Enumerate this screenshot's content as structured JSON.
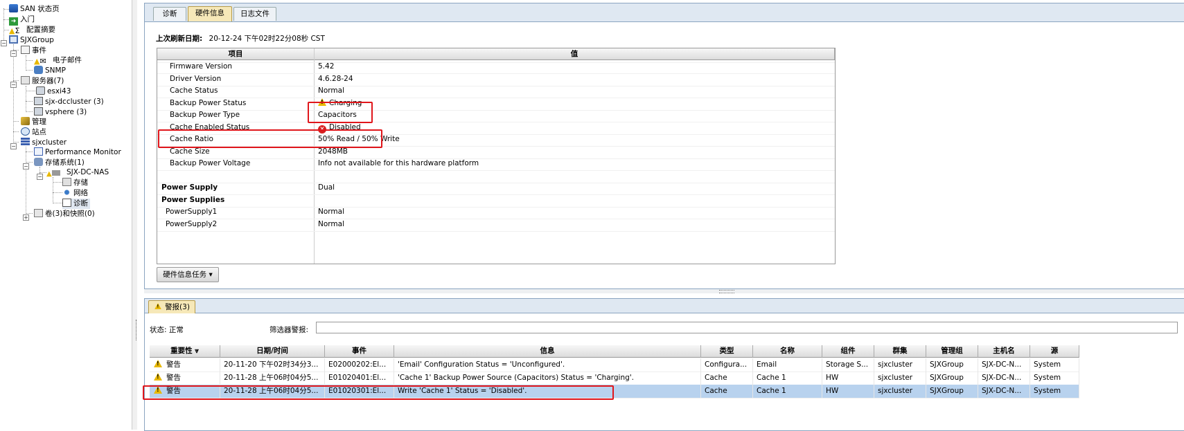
{
  "tree": {
    "items": [
      {
        "label": "SAN 状态页",
        "icon": "san-status-icon"
      },
      {
        "label": "入门",
        "icon": "getting-started-icon"
      },
      {
        "label": "配置摘要",
        "icon": "config-summary-icon"
      },
      {
        "label": "SJXGroup",
        "icon": "management-group-icon"
      },
      {
        "label": "事件",
        "icon": "events-icon"
      },
      {
        "label": "电子邮件",
        "icon": "email-icon"
      },
      {
        "label": "SNMP",
        "icon": "snmp-icon"
      },
      {
        "label": "服务器(7)",
        "icon": "servers-icon"
      },
      {
        "label": "esxi43",
        "icon": "server-icon"
      },
      {
        "label": "sjx-dccluster (3)",
        "icon": "server-cluster-icon"
      },
      {
        "label": "vsphere (3)",
        "icon": "server-cluster-icon"
      },
      {
        "label": "管理",
        "icon": "admin-icon"
      },
      {
        "label": "站点",
        "icon": "sites-icon"
      },
      {
        "label": "sjxcluster",
        "icon": "cluster-icon"
      },
      {
        "label": "Performance Monitor",
        "icon": "performance-monitor-icon"
      },
      {
        "label": "存储系统(1)",
        "icon": "storage-systems-icon"
      },
      {
        "label": "SJX-DC-NAS",
        "icon": "storage-system-icon"
      },
      {
        "label": "存储",
        "icon": "storage-icon"
      },
      {
        "label": "网络",
        "icon": "network-icon"
      },
      {
        "label": "诊断",
        "icon": "diagnostics-icon"
      },
      {
        "label": "卷(3)和快照(0)",
        "icon": "volumes-icon"
      }
    ]
  },
  "hardware": {
    "tabs": [
      {
        "label": "诊断"
      },
      {
        "label": "硬件信息"
      },
      {
        "label": "日志文件"
      }
    ],
    "refresh_label": "上次刷新日期:",
    "refresh_value": "20-12-24 下午02时22分08秒 CST",
    "columns": {
      "item": "项目",
      "value": "值"
    },
    "rows": [
      {
        "item": "Firmware Version",
        "value": "5.42"
      },
      {
        "item": "Driver Version",
        "value": "4.6.28-24"
      },
      {
        "item": "Cache Status",
        "value": "Normal"
      },
      {
        "item": "Backup Power Status",
        "value": "Charging",
        "status": "warning"
      },
      {
        "item": "Backup Power Type",
        "value": "Capacitors"
      },
      {
        "item": "Cache Enabled Status",
        "value": "Disabled",
        "status": "error"
      },
      {
        "item": "Cache Ratio",
        "value": "50% Read / 50% Write"
      },
      {
        "item": "Cache Size",
        "value": "2048MB"
      },
      {
        "item": "Backup Power Voltage",
        "value": "Info not available for this hardware platform"
      },
      {
        "item": "",
        "value": ""
      },
      {
        "item": "Power Supply",
        "value": "Dual"
      },
      {
        "item": "Power Supplies",
        "value": ""
      },
      {
        "item": "PowerSupply1",
        "value": "Normal"
      },
      {
        "item": "PowerSupply2",
        "value": "Normal"
      }
    ],
    "task_button": "硬件信息任务 ▾"
  },
  "alarms": {
    "tab_label": "警报(3)",
    "status_label": "状态: 正常",
    "filter_label": "筛选器警报:",
    "filter_value": "",
    "columns": [
      "重要性",
      "日期/时间",
      "事件",
      "信息",
      "类型",
      "名称",
      "组件",
      "群集",
      "管理组",
      "主机名",
      "源"
    ],
    "rows": [
      {
        "severity": "警告",
        "datetime": "20-11-20 下午02时34分3...",
        "event": "E02000202:El...",
        "info": "'Email' Configuration Status = 'Unconfigured'.",
        "type": "Configura...",
        "name": "Email",
        "component": "Storage S...",
        "cluster": "sjxcluster",
        "group": "SJXGroup",
        "host": "SJX-DC-N...",
        "source": "System"
      },
      {
        "severity": "警告",
        "datetime": "20-11-28 上午06时04分5...",
        "event": "E01020401:El...",
        "info": "'Cache 1' Backup Power Source (Capacitors) Status = 'Charging'.",
        "type": "Cache",
        "name": "Cache 1",
        "component": "HW",
        "cluster": "sjxcluster",
        "group": "SJXGroup",
        "host": "SJX-DC-N...",
        "source": "System"
      },
      {
        "severity": "警告",
        "datetime": "20-11-28 上午06时04分5...",
        "event": "E01020301:El...",
        "info": "Write 'Cache 1' Status = 'Disabled'.",
        "type": "Cache",
        "name": "Cache 1",
        "component": "HW",
        "cluster": "sjxcluster",
        "group": "SJXGroup",
        "host": "SJX-DC-N...",
        "source": "System"
      }
    ]
  },
  "colors": {
    "highlight_box": "#e0161b",
    "selected_row": "#b8d2ee",
    "active_tab": "#f6e8b8",
    "warning": "#e8b800",
    "error": "#d62020"
  }
}
